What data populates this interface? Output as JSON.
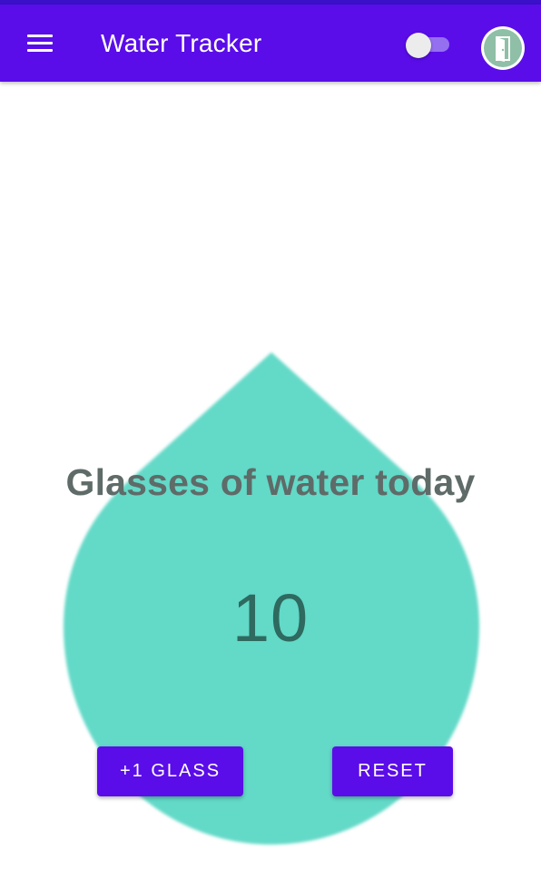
{
  "colors": {
    "app_bar": "#5a0de8",
    "status_bar": "#3a10c8",
    "drop_fill": "#64d9c8",
    "headline_text": "#5f6b68",
    "count_text": "#2e6a5f",
    "button_bg": "#5a0de8",
    "button_text": "#ffffff"
  },
  "app_bar": {
    "title": "Water Tracker",
    "menu_icon": "hamburger-menu-icon",
    "toggle": {
      "state": "off",
      "icon": "toggle-switch-icon"
    },
    "avatar_icon": "door-icon"
  },
  "tracker": {
    "headline": "Glasses of water today",
    "count": "10",
    "drop_icon": "water-drop-icon",
    "add_button_label": "+1 GLASS",
    "reset_button_label": "RESET"
  }
}
